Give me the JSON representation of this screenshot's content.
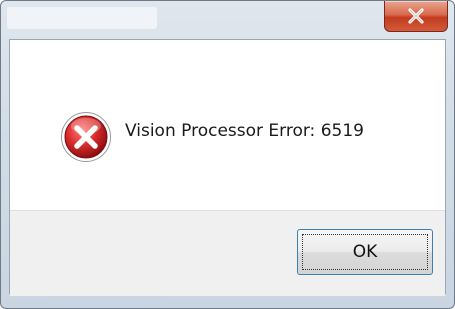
{
  "window": {
    "title": "",
    "close_icon": "close-icon"
  },
  "message": {
    "icon": "error-icon",
    "text": "Vision Processor Error: 6519"
  },
  "buttons": {
    "ok_label": "OK"
  },
  "colors": {
    "close_button": "#c94a2d",
    "error_icon": "#c8202a",
    "button_area": "#f0f0f0",
    "focus_border": "#3c7fb1"
  }
}
